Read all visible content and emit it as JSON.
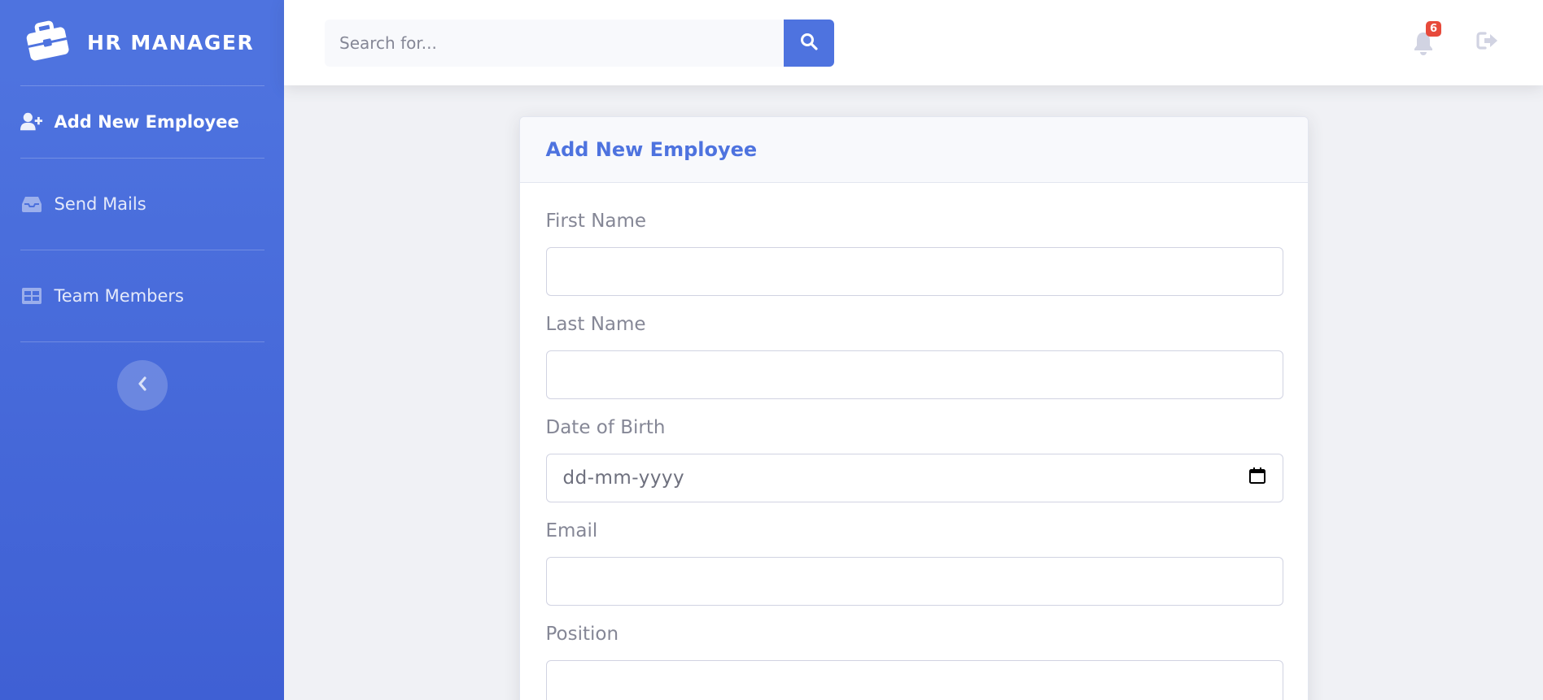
{
  "brand": {
    "title": "HR MANAGER",
    "icon": "briefcase-icon"
  },
  "sidebar": {
    "items": [
      {
        "label": "Add New Employee",
        "icon": "user-plus-icon",
        "active": true
      },
      {
        "label": "Send Mails",
        "icon": "inbox-icon",
        "active": false
      },
      {
        "label": "Team Members",
        "icon": "table-icon",
        "active": false
      }
    ],
    "toggle_icon": "chevron-left-icon"
  },
  "topbar": {
    "search_placeholder": "Search for...",
    "search_value": "",
    "notification_count": "6"
  },
  "form": {
    "title": "Add New Employee",
    "fields": [
      {
        "label": "First Name",
        "value": ""
      },
      {
        "label": "Last Name",
        "value": ""
      },
      {
        "label": "Date of Birth",
        "placeholder": "dd-mm-yyyy"
      },
      {
        "label": "Email",
        "value": ""
      },
      {
        "label": "Position",
        "value": ""
      }
    ]
  },
  "colors": {
    "primary": "#4e73df",
    "danger": "#e74a3b",
    "text_muted": "#858796"
  }
}
